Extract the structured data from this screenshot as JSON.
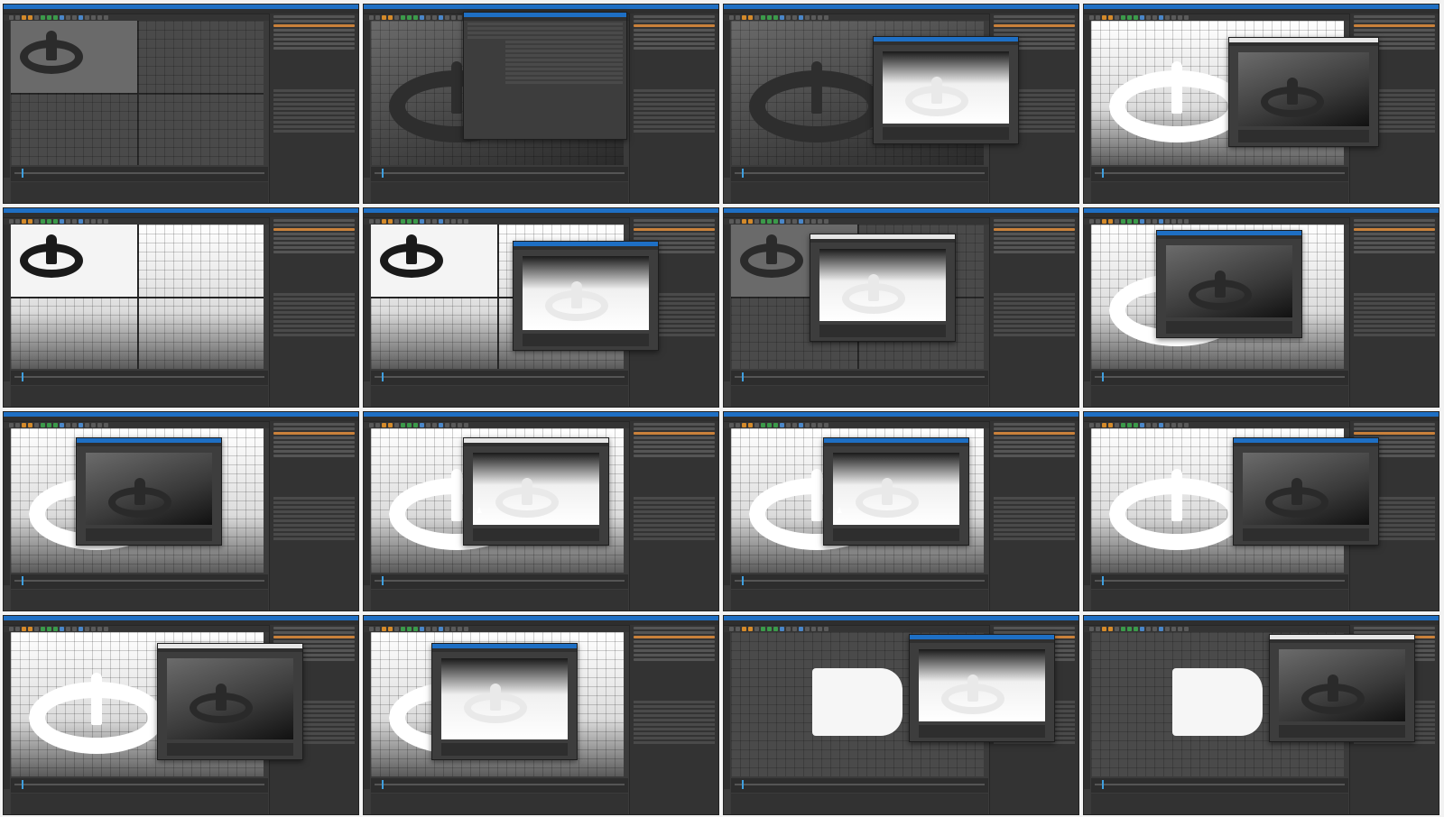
{
  "sheet": {
    "columns": 4,
    "rows": 4,
    "frame_count": 16
  },
  "frames": [
    {
      "id": 1,
      "view": "quad",
      "viewport": "grey",
      "dialog": "none"
    },
    {
      "id": 2,
      "view": "perspective",
      "viewport": "grey",
      "dialog": "render-settings"
    },
    {
      "id": 3,
      "view": "perspective",
      "viewport": "grey",
      "dialog": "picture-viewer"
    },
    {
      "id": 4,
      "view": "perspective",
      "viewport": "white",
      "dialog": "picture-viewer"
    },
    {
      "id": 5,
      "view": "quad",
      "viewport": "white",
      "dialog": "none"
    },
    {
      "id": 6,
      "view": "quad",
      "viewport": "white",
      "dialog": "picture-viewer"
    },
    {
      "id": 7,
      "view": "quad",
      "viewport": "grey",
      "dialog": "picture-viewer"
    },
    {
      "id": 8,
      "view": "perspective",
      "viewport": "white",
      "dialog": "picture-viewer"
    },
    {
      "id": 9,
      "view": "perspective",
      "viewport": "white",
      "dialog": "picture-viewer"
    },
    {
      "id": 10,
      "view": "perspective",
      "viewport": "white",
      "dialog": "picture-viewer"
    },
    {
      "id": 11,
      "view": "perspective",
      "viewport": "white",
      "dialog": "picture-viewer"
    },
    {
      "id": 12,
      "view": "perspective",
      "viewport": "white",
      "dialog": "picture-viewer"
    },
    {
      "id": 13,
      "view": "perspective",
      "viewport": "white",
      "dialog": "picture-viewer"
    },
    {
      "id": 14,
      "view": "perspective",
      "viewport": "white",
      "dialog": "picture-viewer"
    },
    {
      "id": 15,
      "view": "front",
      "viewport": "grey",
      "dialog": "picture-viewer"
    },
    {
      "id": 16,
      "view": "front",
      "viewport": "grey",
      "dialog": "picture-viewer"
    }
  ],
  "colors": {
    "title_bar": "#1e6fc4",
    "ui_background": "#3b3b3b",
    "selection": "#c9813b",
    "playhead": "#3fa0e0"
  }
}
